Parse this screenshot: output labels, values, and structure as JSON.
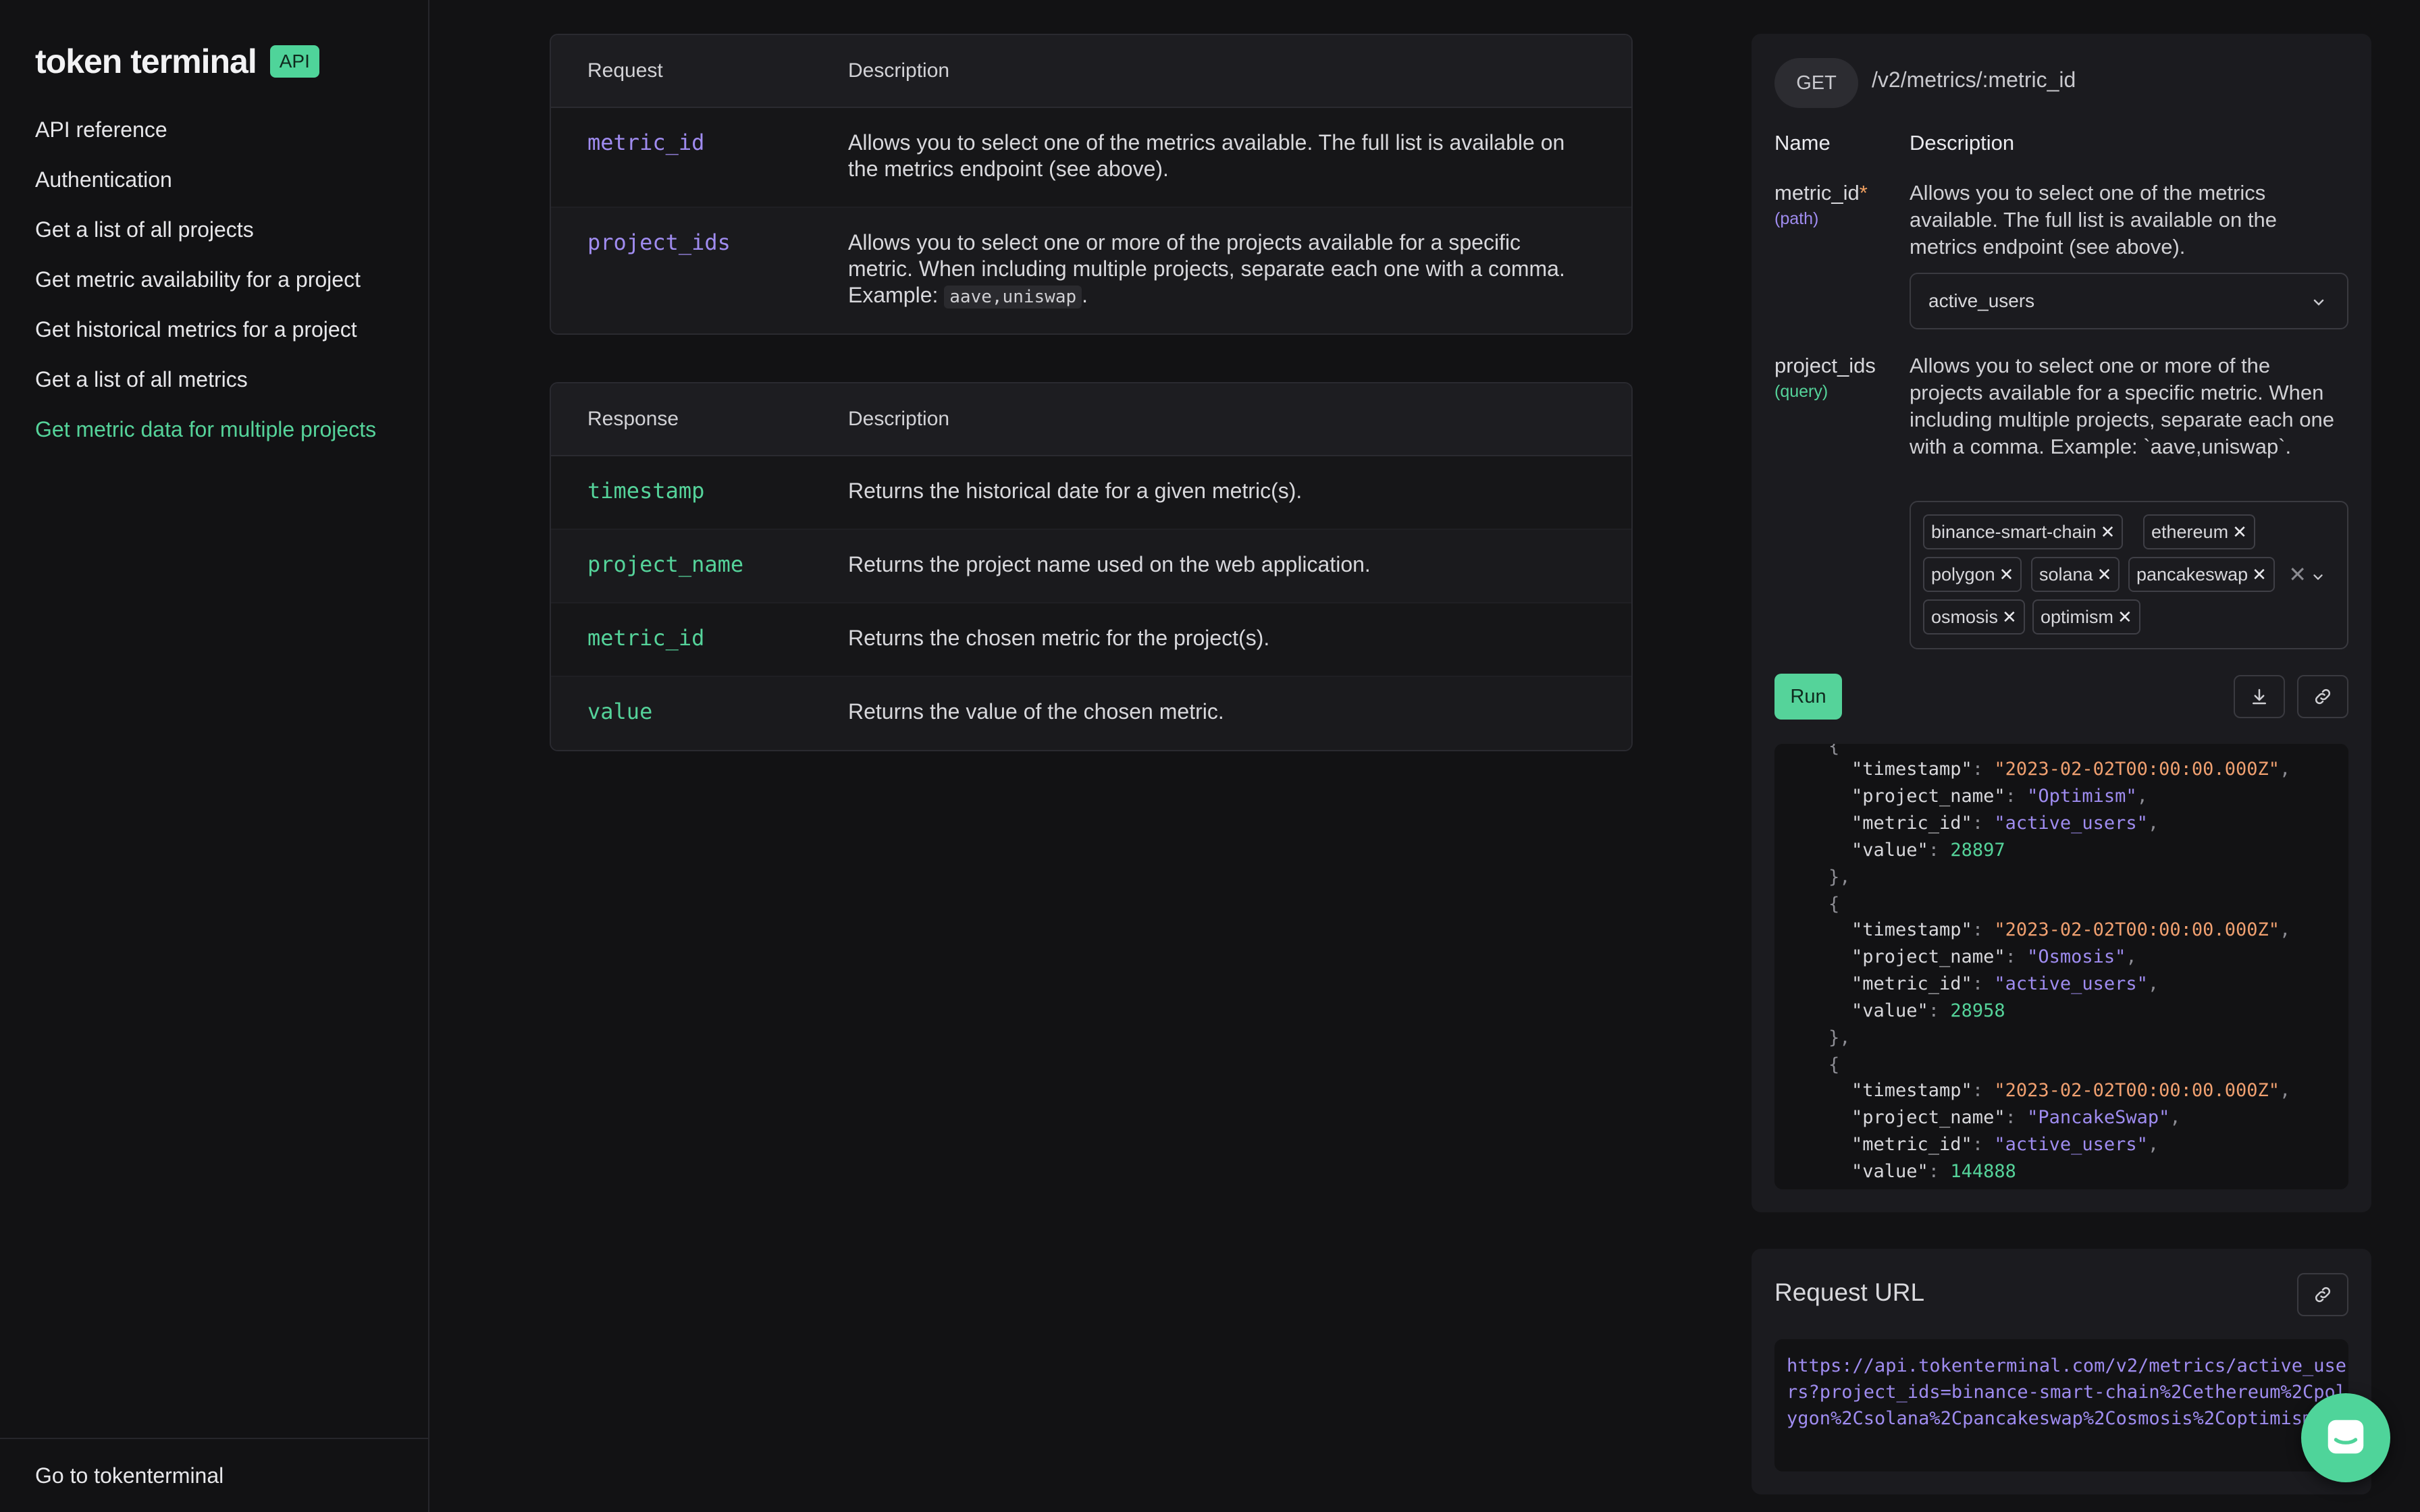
{
  "brand": {
    "name": "token terminal",
    "badge": "API"
  },
  "nav": [
    {
      "label": "API reference",
      "active": false
    },
    {
      "label": "Authentication",
      "active": false
    },
    {
      "label": "Get a list of all projects",
      "active": false
    },
    {
      "label": "Get metric availability for a project",
      "active": false
    },
    {
      "label": "Get historical metrics for a project",
      "active": false
    },
    {
      "label": "Get a list of all metrics",
      "active": false
    },
    {
      "label": "Get metric data for multiple projects",
      "active": true
    }
  ],
  "sidebar_footer": "Go to tokenterminal",
  "request_table": {
    "headers": [
      "Request",
      "Description"
    ],
    "rows": [
      {
        "name": "metric_id",
        "desc": "Allows you to select one of the metrics available. The full list is available on the metrics endpoint (see above)."
      },
      {
        "name": "project_ids",
        "desc_before": "Allows you to select one or more of the projects available for a specific metric. When including multiple projects, separate each one with a comma. Example: ",
        "desc_code": "aave,uniswap",
        "desc_after": "."
      }
    ]
  },
  "response_table": {
    "headers": [
      "Response",
      "Description"
    ],
    "rows": [
      {
        "name": "timestamp",
        "desc": "Returns the historical date for a given metric(s)."
      },
      {
        "name": "project_name",
        "desc": "Returns the project name used on the web application."
      },
      {
        "name": "metric_id",
        "desc": "Returns the chosen metric for the project(s)."
      },
      {
        "name": "value",
        "desc": "Returns the value of the chosen metric."
      }
    ]
  },
  "endpoint": {
    "method": "GET",
    "path": "/v2/metrics/:metric_id"
  },
  "params_header": {
    "name": "Name",
    "desc": "Description"
  },
  "params": {
    "metric_id": {
      "name": "metric_id",
      "required_mark": "*",
      "location": "(path)",
      "desc": "Allows you to select one of the metrics available. The full list is available on the metrics endpoint (see above).",
      "selected": "active_users"
    },
    "project_ids": {
      "name": "project_ids",
      "location": "(query)",
      "desc": "Allows you to select one or more of the projects available for a specific metric. When including multiple projects, separate each one with a comma. Example: `aave,uniswap`.",
      "chips": [
        "binance-smart-chain",
        "ethereum",
        "polygon",
        "solana",
        "pancakeswap",
        "osmosis",
        "optimism"
      ],
      "clear_glyph": "✕"
    }
  },
  "run_label": "Run",
  "response_json": [
    {
      "timestamp": "\"2023-02-02T00:00:00.000Z\"",
      "project_name": "\"Optimism\"",
      "metric_id": "\"active_users\"",
      "value": "28897"
    },
    {
      "timestamp": "\"2023-02-02T00:00:00.000Z\"",
      "project_name": "\"Osmosis\"",
      "metric_id": "\"active_users\"",
      "value": "28958"
    },
    {
      "timestamp": "\"2023-02-02T00:00:00.000Z\"",
      "project_name": "\"PancakeSwap\"",
      "metric_id": "\"active_users\"",
      "value": "144888"
    }
  ],
  "json_keys": {
    "timestamp": "\"timestamp\"",
    "project_name": "\"project_name\"",
    "metric_id": "\"metric_id\"",
    "value": "\"value\""
  },
  "request_url": {
    "title": "Request URL",
    "url": "https://api.tokenterminal.com/v2/metrics/active_users?project_ids=binance-smart-chain%2Cethereum%2Cpolygon%2Csolana%2Cpancakeswap%2Cosmosis%2Coptimism"
  },
  "colors": {
    "accent": "#55d39a",
    "purple": "#9f8cf0",
    "orange": "#f0a070",
    "background": "#121214"
  }
}
